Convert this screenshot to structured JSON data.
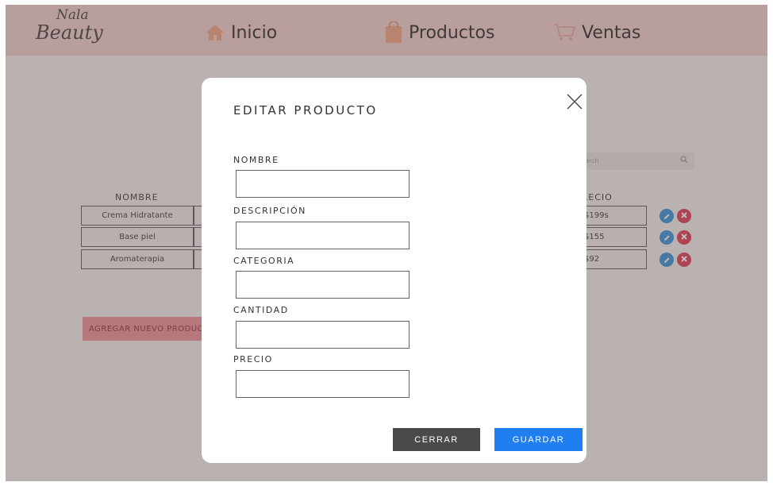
{
  "brand": {
    "logo_line1": "Nala",
    "logo_line2": "Beauty"
  },
  "nav": {
    "inicio": "Inicio",
    "productos": "Productos",
    "ventas": "Ventas"
  },
  "search": {
    "placeholder": "Search"
  },
  "table": {
    "headers": {
      "nombre": "NOMBRE",
      "precio": "PRECIO"
    },
    "rows": [
      {
        "nombre": "Crema Hidratante",
        "precio": "$199s"
      },
      {
        "nombre": "Base piel",
        "precio": "$155"
      },
      {
        "nombre": "Aromaterapia",
        "precio": "$92"
      }
    ]
  },
  "add_button": "AGREGAR NUEVO PRODUCTO",
  "modal": {
    "title": "EDITAR PRODUCTO",
    "fields": {
      "nombre": {
        "label": "NOMBRE",
        "value": ""
      },
      "descripcion": {
        "label": "DESCRIPCIÓN",
        "value": ""
      },
      "categoria": {
        "label": "CATEGORIA",
        "value": ""
      },
      "cantidad": {
        "label": "CANTIDAD",
        "value": ""
      },
      "precio": {
        "label": "PRECIO",
        "value": ""
      }
    },
    "cerrar": "CERRAR",
    "guardar": "GUARDAR"
  },
  "colors": {
    "header_bg": "#f3cfcf",
    "add_button_bg": "#f08d94",
    "edit_icon": "#2e8fd8",
    "delete_icon": "#e0344c",
    "cerrar_bg": "#4a4a4a",
    "guardar_bg": "#1f7ef0"
  },
  "icons": {
    "inicio": "home-icon",
    "productos": "shopping-bag-icon",
    "ventas": "cart-icon",
    "search": "search-icon",
    "edit": "pencil-icon",
    "delete": "close-circle-icon",
    "modal_close": "close-icon"
  }
}
